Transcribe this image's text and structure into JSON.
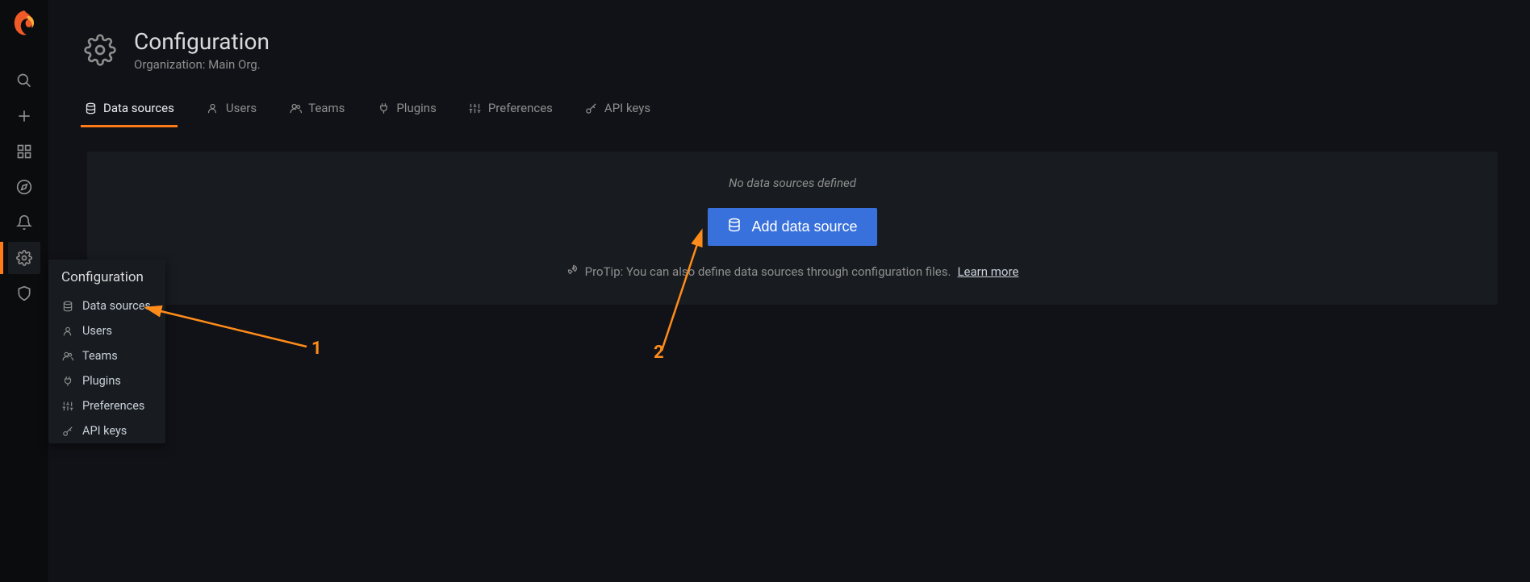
{
  "header": {
    "title": "Configuration",
    "subtitle": "Organization: Main Org."
  },
  "tabs": [
    {
      "label": "Data sources",
      "icon": "database-icon",
      "active": true
    },
    {
      "label": "Users",
      "icon": "user-icon",
      "active": false
    },
    {
      "label": "Teams",
      "icon": "users-icon",
      "active": false
    },
    {
      "label": "Plugins",
      "icon": "plug-icon",
      "active": false
    },
    {
      "label": "Preferences",
      "icon": "sliders-icon",
      "active": false
    },
    {
      "label": "API keys",
      "icon": "key-icon",
      "active": false
    }
  ],
  "content": {
    "empty_message": "No data sources defined",
    "add_button_label": "Add data source",
    "protip_prefix": "ProTip: You can also define data sources through configuration files.",
    "learn_more": "Learn more"
  },
  "popup": {
    "title": "Configuration",
    "items": [
      {
        "label": "Data sources",
        "icon": "database-icon"
      },
      {
        "label": "Users",
        "icon": "user-icon"
      },
      {
        "label": "Teams",
        "icon": "users-icon"
      },
      {
        "label": "Plugins",
        "icon": "plug-icon"
      },
      {
        "label": "Preferences",
        "icon": "sliders-icon"
      },
      {
        "label": "API keys",
        "icon": "key-icon"
      }
    ]
  },
  "annotations": {
    "label1": "1",
    "label2": "2"
  },
  "colors": {
    "accent": "#ff7b18",
    "primary_button": "#3871dc",
    "background": "#111217",
    "panel": "#181b1f"
  }
}
